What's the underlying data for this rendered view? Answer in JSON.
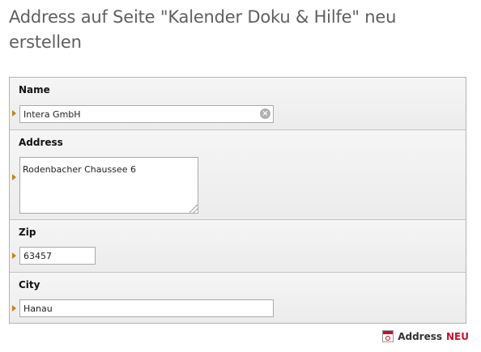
{
  "page": {
    "title": "Address auf Seite \"Kalender Doku & Hilfe\" neu erstellen"
  },
  "form": {
    "name": {
      "label": "Name",
      "value": "Intera GmbH",
      "clear_icon": "clear-circle-icon"
    },
    "address": {
      "label": "Address",
      "value": "Rodenbacher Chaussee 6"
    },
    "zip": {
      "label": "Zip",
      "value": "63457"
    },
    "city": {
      "label": "City",
      "value": "Hanau"
    }
  },
  "footer": {
    "link_label": "Address",
    "link_badge": "NEU",
    "icon": "calendar-address-icon"
  },
  "colors": {
    "title": "#5f5f5f",
    "marker": "#c4821c",
    "accent_red": "#c8102e",
    "row_bg": "#f1f1f1",
    "border": "#b3b3b3"
  }
}
